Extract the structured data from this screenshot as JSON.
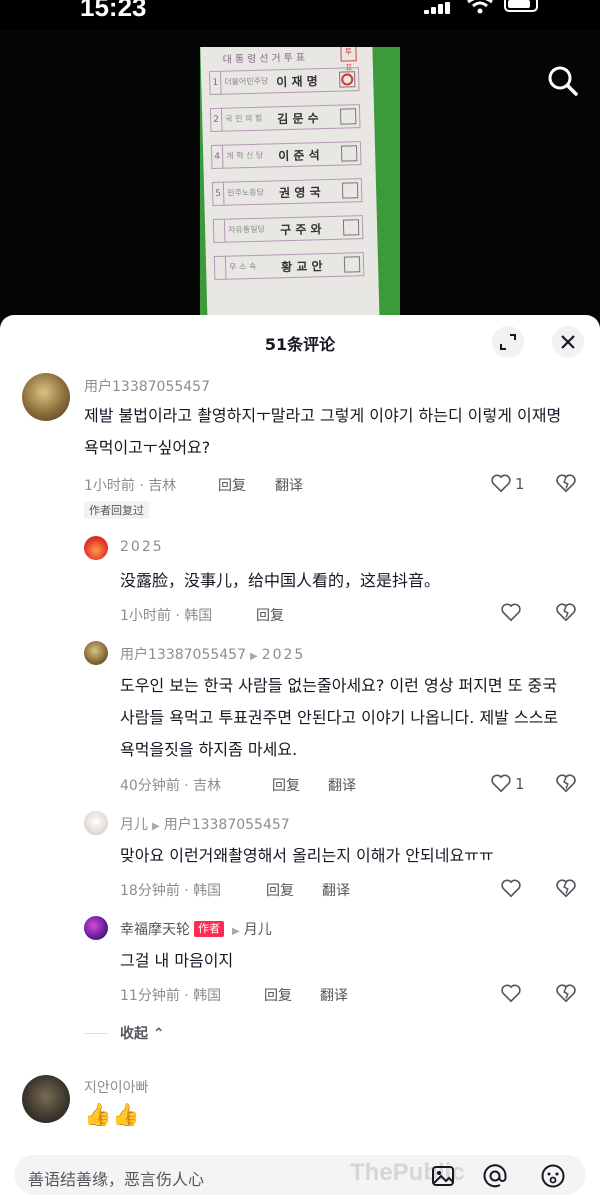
{
  "status": {
    "time": "15:23"
  },
  "video": {
    "ballot": {
      "header": "대통령선거투표",
      "stamp": "투표",
      "rows": [
        {
          "num": "1",
          "party": "더불어민주당",
          "name": "이 재 명",
          "marked": true
        },
        {
          "num": "2",
          "party": "국 민 의 힘",
          "name": "김 문 수",
          "marked": false
        },
        {
          "num": "4",
          "party": "개 혁 신 당",
          "name": "이 준 석",
          "marked": false
        },
        {
          "num": "5",
          "party": "민주노동당",
          "name": "권 영 국",
          "marked": false
        },
        {
          "num": "",
          "party": "자유통일당",
          "name": "구 주 와",
          "marked": false
        },
        {
          "num": "",
          "party": "무 소 속",
          "name": "황 교 안",
          "marked": false
        }
      ]
    }
  },
  "sheet": {
    "title": "51条评论"
  },
  "comments": [
    {
      "user": "用户13387055457",
      "text": "제발 불법이라고 촬영하지ㅜ말라고 그렇게 이야기 하는디 이렇게 이재명 욕먹이고ㅜ싶어요?",
      "meta": "1小时前 · 吉林",
      "reply": "回复",
      "translate": "翻译",
      "likes": "1",
      "tag": "作者回复过"
    }
  ],
  "replies": [
    {
      "user": "2025",
      "reply_to": "",
      "badge": "",
      "text": "没露脸，没事儿，给中国人看的，这是抖音。",
      "meta": "1小时前 · 韩国",
      "reply": "回复",
      "translate": "",
      "likes": ""
    },
    {
      "user": "用户13387055457",
      "reply_to": "2025",
      "badge": "",
      "text": "도우인 보는 한국 사람들 없는줄아세요? 이런 영상 퍼지면 또 중국사람들 욕먹고 투표권주면 안된다고 이야기 나옵니다. 제발 스스로 욕먹을짓을 하지좀 마세요.",
      "meta": "40分钟前 · 吉林",
      "reply": "回复",
      "translate": "翻译",
      "likes": "1"
    },
    {
      "user": "月儿",
      "reply_to": "用户13387055457",
      "badge": "",
      "text": "맞아요 이런거왜촬영해서 올리는지 이해가 안되네요ㅠㅠ",
      "meta": "18分钟前 · 韩国",
      "reply": "回复",
      "translate": "翻译",
      "likes": ""
    },
    {
      "user": "幸福摩天轮",
      "reply_to": "月儿",
      "badge": "作者",
      "text": "그걸 내 마음이지",
      "meta": "11分钟前 · 韩国",
      "reply": "回复",
      "translate": "翻译",
      "likes": ""
    }
  ],
  "collapse_label": "收起",
  "last_comment": {
    "user": "지안이아빠"
  },
  "input": {
    "placeholder": "善语结善缘，恶言伤人心"
  },
  "watermark": "ThePublic"
}
